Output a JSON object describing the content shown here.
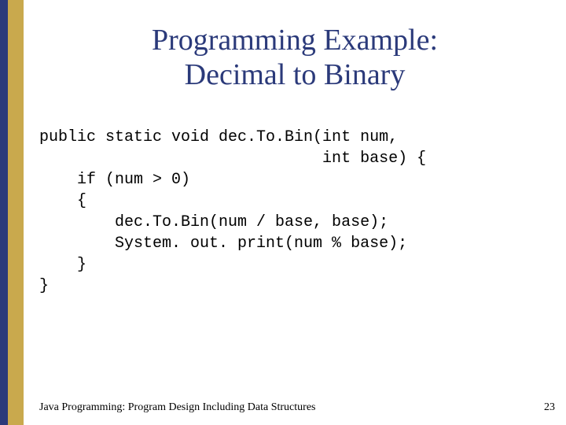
{
  "title": {
    "line1": "Programming Example:",
    "line2": "Decimal to Binary"
  },
  "code": {
    "lines": [
      "public static void dec.To.Bin(int num,",
      "                              int base) {",
      "    if (num > 0)",
      "    {",
      "        dec.To.Bin(num / base, base);",
      "        System. out. print(num % base);",
      "    }",
      "}"
    ]
  },
  "footer": {
    "text": "Java Programming: Program Design Including Data Structures",
    "page": "23"
  }
}
